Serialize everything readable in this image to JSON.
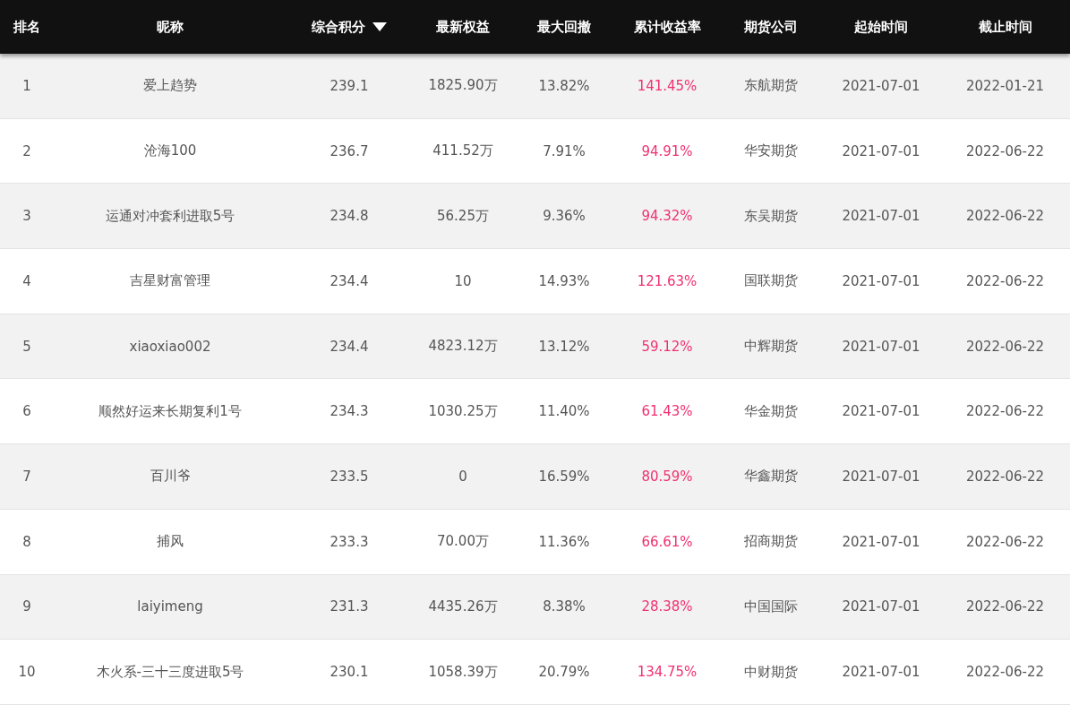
{
  "table": {
    "columns": [
      {
        "label": "排名",
        "sorted": false
      },
      {
        "label": "昵称",
        "sorted": false
      },
      {
        "label": "综合积分",
        "sorted": true
      },
      {
        "label": "最新权益",
        "sorted": false
      },
      {
        "label": "最大回撤",
        "sorted": false
      },
      {
        "label": "累计收益率",
        "sorted": false
      },
      {
        "label": "期货公司",
        "sorted": false
      },
      {
        "label": "起始时间",
        "sorted": false
      },
      {
        "label": "截止时间",
        "sorted": false
      }
    ],
    "rows": [
      [
        "1",
        "爱上趋势",
        "239.1",
        "1825.90万",
        "13.82%",
        "141.45%",
        "东航期货",
        "2021-07-01",
        "2022-01-21"
      ],
      [
        "2",
        "沧海100",
        "236.7",
        "411.52万",
        "7.91%",
        "94.91%",
        "华安期货",
        "2021-07-01",
        "2022-06-22"
      ],
      [
        "3",
        "运通对冲套利进取5号",
        "234.8",
        "56.25万",
        "9.36%",
        "94.32%",
        "东吴期货",
        "2021-07-01",
        "2022-06-22"
      ],
      [
        "4",
        "吉星财富管理",
        "234.4",
        "10",
        "14.93%",
        "121.63%",
        "国联期货",
        "2021-07-01",
        "2022-06-22"
      ],
      [
        "5",
        "xiaoxiao002",
        "234.4",
        "4823.12万",
        "13.12%",
        "59.12%",
        "中辉期货",
        "2021-07-01",
        "2022-06-22"
      ],
      [
        "6",
        "顺然好运来长期复利1号",
        "234.3",
        "1030.25万",
        "11.40%",
        "61.43%",
        "华金期货",
        "2021-07-01",
        "2022-06-22"
      ],
      [
        "7",
        "百川爷",
        "233.5",
        "0",
        "16.59%",
        "80.59%",
        "华鑫期货",
        "2021-07-01",
        "2022-06-22"
      ],
      [
        "8",
        "捕风",
        "233.3",
        "70.00万",
        "11.36%",
        "66.61%",
        "招商期货",
        "2021-07-01",
        "2022-06-22"
      ],
      [
        "9",
        "laiyimeng",
        "231.3",
        "4435.26万",
        "8.38%",
        "28.38%",
        "中国国际",
        "2021-07-01",
        "2022-06-22"
      ],
      [
        "10",
        "木火系-三十三度进取5号",
        "230.1",
        "1058.39万",
        "20.79%",
        "134.75%",
        "中财期货",
        "2021-07-01",
        "2022-06-22"
      ]
    ]
  }
}
